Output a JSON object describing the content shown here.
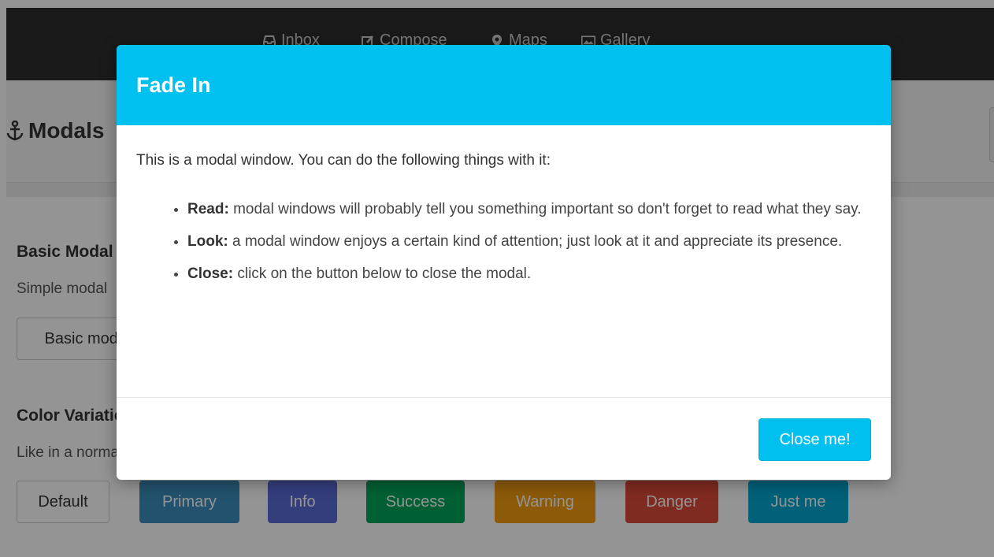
{
  "nav": {
    "items": [
      {
        "label": "Inbox",
        "icon": "inbox-icon"
      },
      {
        "label": "Compose",
        "icon": "compose-icon"
      },
      {
        "label": "Maps",
        "icon": "map-marker-icon"
      },
      {
        "label": "Gallery",
        "icon": "picture-icon"
      }
    ]
  },
  "page": {
    "title": "Modals",
    "title_icon": "anchor-icon"
  },
  "basic": {
    "title": "Basic Modal",
    "desc": "Simple modal",
    "button": "Basic modal"
  },
  "colors": {
    "title": "Color Variations",
    "desc": "Like in a normal",
    "buttons": [
      {
        "label": "Default",
        "color": "#ffffff"
      },
      {
        "label": "Primary",
        "color": "#3c8dbc"
      },
      {
        "label": "Info",
        "color": "#5b6bd8"
      },
      {
        "label": "Success",
        "color": "#00a65a"
      },
      {
        "label": "Warning",
        "color": "#f39c12"
      },
      {
        "label": "Danger",
        "color": "#dd4b39"
      },
      {
        "label": "Just me",
        "color": "#00a7d0"
      }
    ]
  },
  "modal": {
    "title": "Fade In",
    "intro": "This is a modal window. You can do the following things with it:",
    "items": [
      {
        "term": "Read:",
        "text": " modal windows will probably tell you something important so don't forget to read what they say."
      },
      {
        "term": "Look:",
        "text": " a modal window enjoys a certain kind of attention; just look at it and appreciate its presence."
      },
      {
        "term": "Close:",
        "text": " click on the button below to close the modal."
      }
    ],
    "close_label": "Close me!",
    "accent": "#00c0ef"
  }
}
